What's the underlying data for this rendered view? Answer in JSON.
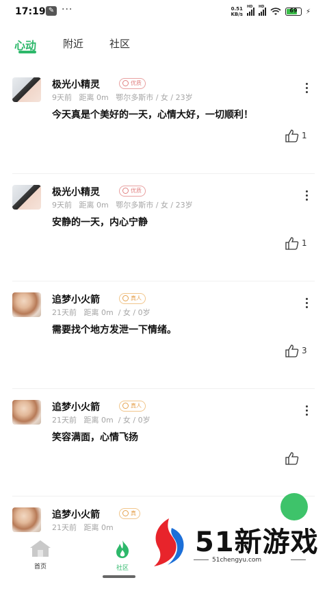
{
  "status_bar": {
    "time": "17:19",
    "speed_value": "0.51",
    "speed_unit": "KB/s",
    "signal_1_label": "HD",
    "signal_2_label": "HD",
    "battery": "69"
  },
  "tabs": [
    {
      "label": "心动",
      "active": true
    },
    {
      "label": "附近",
      "active": false
    },
    {
      "label": "社区",
      "active": false
    }
  ],
  "posts": [
    {
      "name": "极光小精灵",
      "badge": "优质",
      "badge_type": "premium",
      "time": "9天前",
      "distance": "距离 0m",
      "location": "鄂尔多斯市 / 女 / 23岁",
      "content": "今天真是个美好的一天，心情大好，一切顺利！",
      "likes": "1",
      "avatar": "girl-photo"
    },
    {
      "name": "极光小精灵",
      "badge": "优质",
      "badge_type": "premium",
      "time": "9天前",
      "distance": "距离 0m",
      "location": "鄂尔多斯市 / 女 / 23岁",
      "content": "安静的一天，内心宁静",
      "likes": "1",
      "avatar": "girl-photo"
    },
    {
      "name": "追梦小火箭",
      "badge": "真人",
      "badge_type": "real",
      "time": "21天前",
      "distance": "距离 0m",
      "location": "/ 女 / 0岁",
      "content": "需要找个地方发泄一下情绪。",
      "likes": "3",
      "avatar": "flower-photo"
    },
    {
      "name": "追梦小火箭",
      "badge": "真人",
      "badge_type": "real",
      "time": "21天前",
      "distance": "距离 0m",
      "location": "/ 女 / 0岁",
      "content": "笑容满面，心情飞扬",
      "likes": "",
      "avatar": "flower-photo"
    },
    {
      "name": "追梦小火箭",
      "badge": "真",
      "badge_type": "real",
      "time": "21天前",
      "distance": "距离 0m",
      "location": "",
      "content": "",
      "likes": "",
      "avatar": "flower-photo"
    }
  ],
  "bottom_nav": [
    {
      "label": "首页",
      "icon": "home-icon",
      "active": false
    },
    {
      "label": "社区",
      "icon": "flame-icon",
      "active": true
    }
  ],
  "watermark": {
    "text": "51新游戏",
    "url": "51chengyu.com"
  },
  "colors": {
    "accent": "#2db86a",
    "muted": "#a5a5a5",
    "premium_badge": "#e08080",
    "real_badge": "#e5a24f"
  }
}
